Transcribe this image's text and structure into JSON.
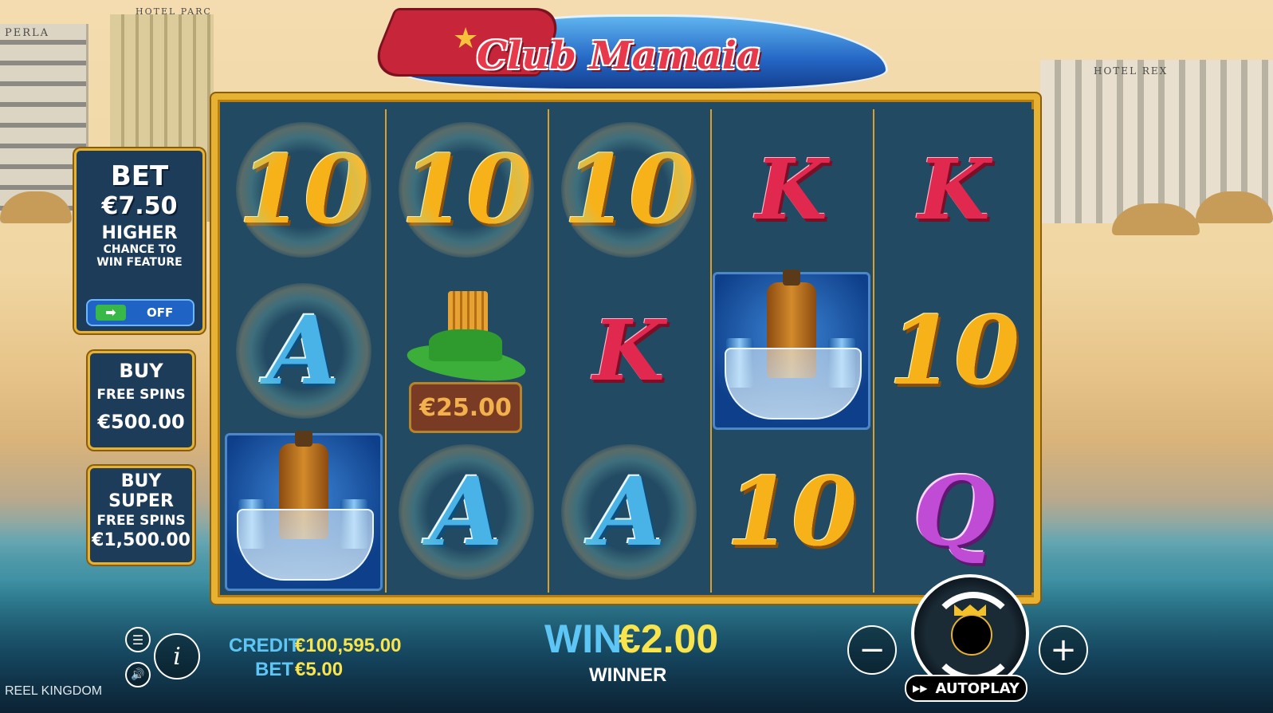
{
  "game": {
    "title": "Club Mamaia",
    "brand": "REEL KINGDOM"
  },
  "background_signs": {
    "left": "PERLA",
    "center": "HOTEL PARC",
    "right": "HOTEL REX"
  },
  "bet_panel": {
    "title": "BET",
    "amount": "€7.50",
    "line1": "HIGHER",
    "line2": "CHANCE TO",
    "line3": "WIN FEATURE",
    "toggle_state": "OFF"
  },
  "buy_free_spins": {
    "line1": "BUY",
    "line2": "FREE SPINS",
    "price": "€500.00"
  },
  "buy_super_free_spins": {
    "line1": "BUY",
    "line2": "SUPER",
    "line3": "FREE SPINS",
    "price": "€1,500.00"
  },
  "reels": [
    [
      "10",
      "A",
      "bottle"
    ],
    [
      "10",
      "hat",
      "A"
    ],
    [
      "10",
      "K",
      "A"
    ],
    [
      "K",
      "bottle",
      "10"
    ],
    [
      "K",
      "10",
      "Q"
    ]
  ],
  "prize_value": "€25.00",
  "footer": {
    "credit_label": "CREDIT",
    "credit_value": "€100,595.00",
    "bet_label": "BET",
    "bet_value": "€5.00",
    "win_label": "WIN",
    "win_value": "€2.00",
    "winner_label": "WINNER",
    "autoplay_label": "AUTOPLAY"
  },
  "colors": {
    "frame_gold": "#e7b231",
    "reel_bg": "#234a63",
    "credit_label": "#5ec6f5",
    "credit_value": "#f8e44c"
  }
}
